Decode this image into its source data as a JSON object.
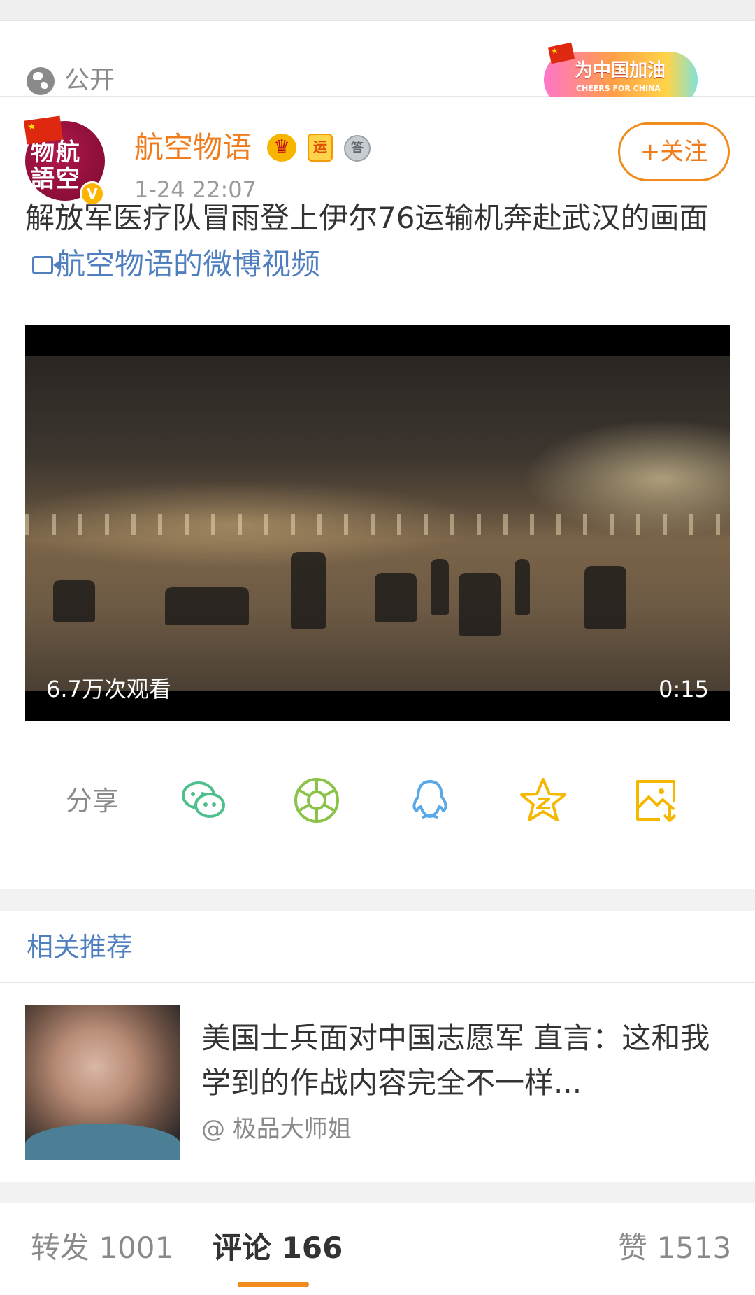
{
  "visibility": {
    "label": "公开"
  },
  "banner": {
    "title": "为中国加油",
    "subtitle": "CHEERS FOR CHINA"
  },
  "post": {
    "username": "航空物语",
    "time": "1-24 22:07",
    "follow_label": "+关注",
    "text": "解放军医疗队冒雨登上伊尔76运输机奔赴武汉的画面",
    "video_link": "航空物语的微博视频",
    "avatar_text": "物航語空",
    "badges": {
      "crown": "♛",
      "yun": "运",
      "ans": "答",
      "verified": "V"
    },
    "video": {
      "views": "6.7万次观看",
      "duration": "0:15"
    }
  },
  "share": {
    "label": "分享",
    "icons": [
      "wechat-icon",
      "moments-icon",
      "qq-icon",
      "qzone-icon",
      "save-image-icon"
    ]
  },
  "related": {
    "heading": "相关推荐",
    "items": [
      {
        "title": "美国士兵面对中国志愿军 直言：这和我学到的作战内容完全不一样...",
        "source": "@ 极品大师姐"
      }
    ]
  },
  "tabs": {
    "repost": "转发 1001",
    "comment": "评论 166",
    "like": "赞 1513"
  },
  "colors": {
    "accent": "#f08b1d",
    "link": "#4f7fbf",
    "wechat": "#4fc08d",
    "moments": "#8bc34a",
    "qq": "#5aa9e6",
    "qzone": "#f5b800",
    "save": "#f5b800"
  }
}
